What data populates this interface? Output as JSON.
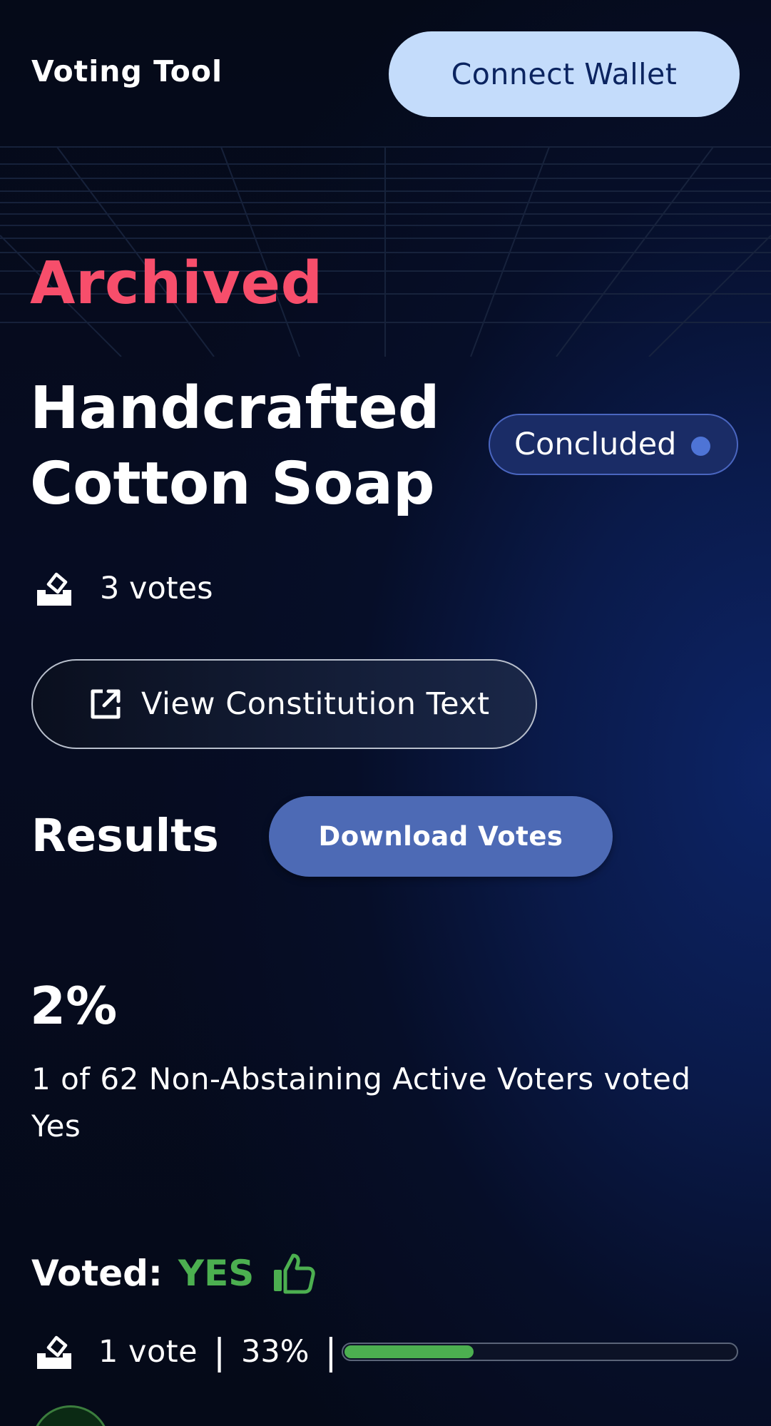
{
  "header": {
    "app_title": "Voting Tool",
    "connect_wallet_label": "Connect Wallet"
  },
  "proposal": {
    "status_heading": "Archived",
    "title_line1": "Handcrafted",
    "title_line2": "Cotton Soap",
    "status_badge": "Concluded",
    "votes_text": "3 votes",
    "constitution_button_label": "View Constitution Text"
  },
  "results": {
    "heading": "Results",
    "download_button_label": "Download Votes",
    "percent": "2%",
    "description": "1 of 62 Non-Abstaining Active Voters voted Yes"
  },
  "voted_option": {
    "label": "Voted:",
    "value": "YES",
    "vote_count_text": "1 vote",
    "separator": "|",
    "percent_text": "33%",
    "progress_fraction": 0.33
  },
  "colors": {
    "accent_archived": "#f74e6b",
    "yes_green": "#4caf50",
    "badge_dot": "#4e74d6",
    "primary_button": "#4d6ab5",
    "connect_button": "#c4dcfb"
  },
  "icons": {
    "ballot": "ballot-box-icon",
    "external_link": "external-link-icon",
    "thumbs_up": "thumbs-up-icon"
  }
}
